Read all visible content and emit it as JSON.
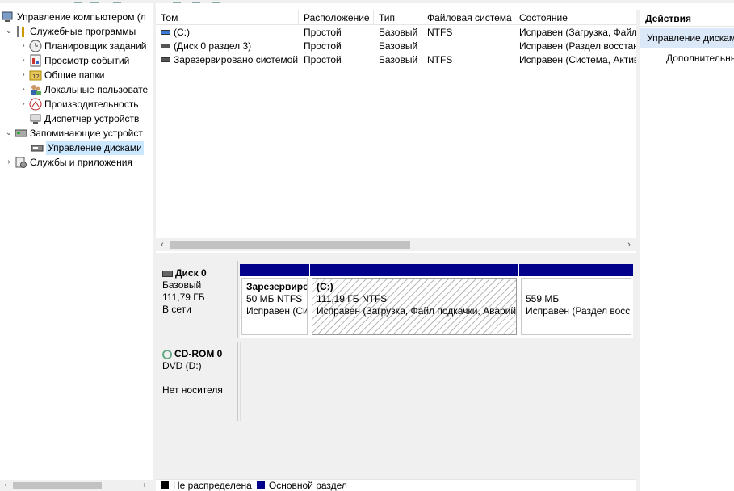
{
  "tree": {
    "root": "Управление компьютером (л",
    "system_tools": "Служебные программы",
    "scheduler": "Планировщик заданий",
    "event_viewer": "Просмотр событий",
    "shared_folders": "Общие папки",
    "local_users": "Локальные пользовате",
    "performance": "Производительность",
    "device_manager": "Диспетчер устройств",
    "storage": "Запоминающие устройст",
    "disk_management": "Управление дисками",
    "services_apps": "Службы и приложения"
  },
  "volumes": {
    "columns": [
      "Том",
      "Расположение",
      "Тип",
      "Файловая система",
      "Состояние"
    ],
    "rows": [
      {
        "name": "(C:)",
        "layout": "Простой",
        "type": "Базовый",
        "fs": "NTFS",
        "status": "Исправен (Загрузка, Файл"
      },
      {
        "name": "(Диск 0 раздел 3)",
        "layout": "Простой",
        "type": "Базовый",
        "fs": "",
        "status": "Исправен (Раздел восстан"
      },
      {
        "name": "Зарезервировано системой",
        "layout": "Простой",
        "type": "Базовый",
        "fs": "NTFS",
        "status": "Исправен (Система, Актив"
      }
    ]
  },
  "disks": {
    "disk0": {
      "name": "Диск 0",
      "type": "Базовый",
      "size": "111,79 ГБ",
      "state": "В сети",
      "partitions": [
        {
          "name": "Зарезервиро",
          "line1": "50 МБ NTFS",
          "line2": "Исправен (Си"
        },
        {
          "name": "(C:)",
          "line1": "111,19 ГБ NTFS",
          "line2": "Исправен (Загрузка, Файл подкачки, Аварий"
        },
        {
          "name": "",
          "line1": "559 МБ",
          "line2": "Исправен (Раздел восс"
        }
      ]
    },
    "cdrom0": {
      "name": "CD-ROM 0",
      "drive": "DVD (D:)",
      "state": "Нет носителя"
    }
  },
  "legend": {
    "unallocated": "Не распределена",
    "primary": "Основной раздел",
    "colors": {
      "unallocated": "#000000",
      "primary": "#00008b"
    }
  },
  "actions": {
    "title": "Действия",
    "group": "Управление дисками",
    "more": "Дополнительные действия"
  }
}
